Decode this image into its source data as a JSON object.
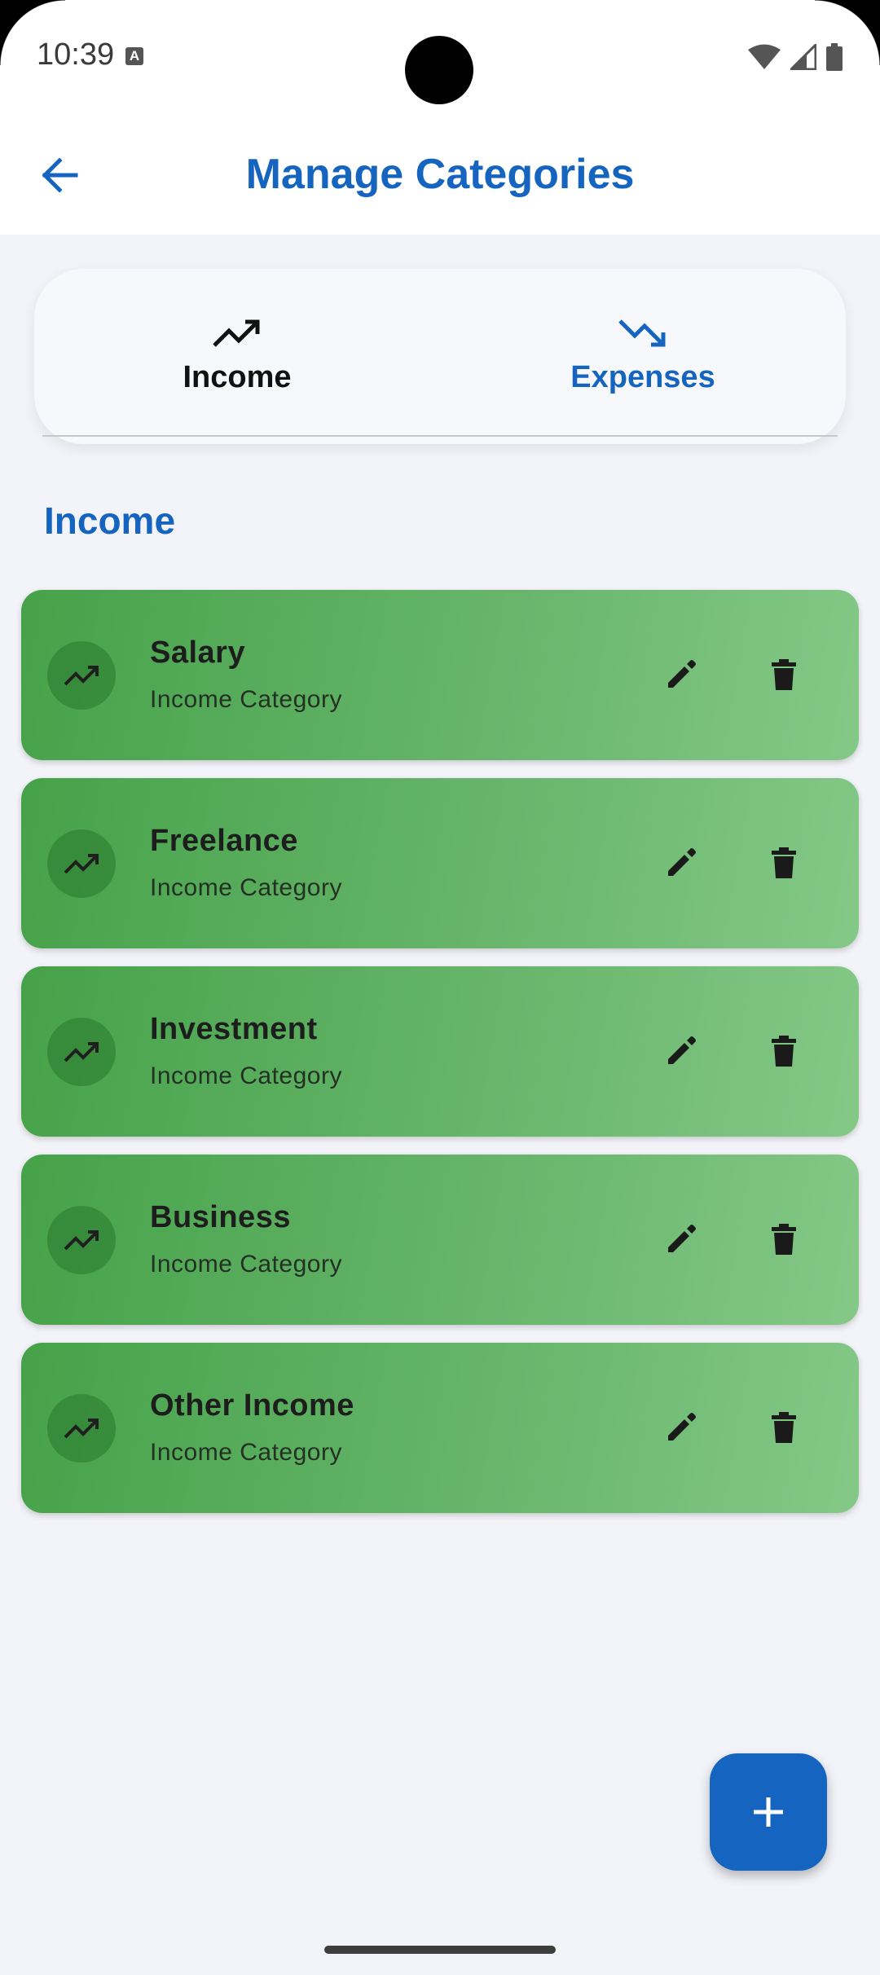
{
  "status_bar": {
    "time": "10:39",
    "notif_letter": "A"
  },
  "app_bar": {
    "title": "Manage Categories"
  },
  "tabs": [
    {
      "label": "Income",
      "icon": "trending-up-icon",
      "selected": true
    },
    {
      "label": "Expenses",
      "icon": "trending-down-icon",
      "selected": false
    }
  ],
  "section": {
    "title": "Income"
  },
  "categories": [
    {
      "name": "Salary",
      "subtitle": "Income Category"
    },
    {
      "name": "Freelance",
      "subtitle": "Income Category"
    },
    {
      "name": "Investment",
      "subtitle": "Income Category"
    },
    {
      "name": "Business",
      "subtitle": "Income Category"
    },
    {
      "name": "Other Income",
      "subtitle": "Income Category"
    }
  ],
  "colors": {
    "accent": "#1565c0",
    "card_start": "#46a249",
    "card_end": "#85c887",
    "background": "#f3f4f9"
  }
}
